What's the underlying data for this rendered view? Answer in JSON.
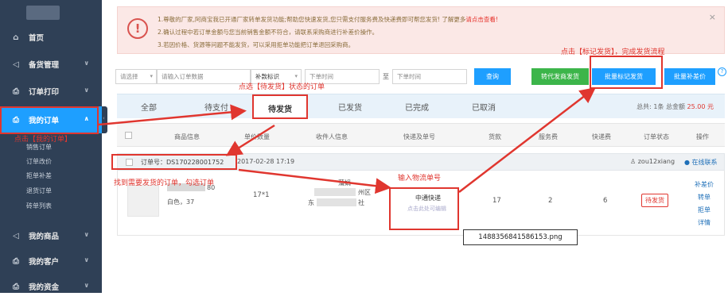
{
  "sidebar": {
    "items": [
      {
        "label": "首页",
        "icon": "home-icon",
        "glyph": "⌂",
        "chevron": ""
      },
      {
        "label": "备货管理",
        "icon": "speaker-icon",
        "glyph": "◁",
        "chevron": "∨"
      },
      {
        "label": "订单打印",
        "icon": "printer-icon",
        "glyph": "⎙",
        "chevron": "∨"
      },
      {
        "label": "我的订单",
        "icon": "printer-icon",
        "glyph": "⎙",
        "chevron": "∧"
      },
      {
        "label": "我的商品",
        "icon": "speaker-icon",
        "glyph": "◁",
        "chevron": "∨"
      },
      {
        "label": "我的客户",
        "icon": "printer-icon",
        "glyph": "⎙",
        "chevron": "∨"
      },
      {
        "label": "我的资金",
        "icon": "printer-icon",
        "glyph": "⎙",
        "chevron": "∨"
      }
    ],
    "subitems": [
      "销售订单",
      "订单改价",
      "拒单补差",
      "退货订单",
      "砖单列表"
    ]
  },
  "notice": {
    "line1_prefix": "1.尊敬的厂家,阿商宝我已开通厂家转单发货功能;帮助您快速发货,您只需支付服务费及快递费即可帮您发货! 了解更多",
    "line1_link": "请点击查看!",
    "line2": "2.确认过程中若订单金额与您当前销售金额不符合，请联系采购商进行补差价操作。",
    "line3": "3.若因价格、货源等问题不能发货，可以采用拒单功能把订单退回采购商。",
    "close": "×"
  },
  "filters": {
    "select1": "请选择",
    "order_placeholder": "请输入订单数据",
    "select2": "补款标识",
    "start_time": "下单时间",
    "range_sep": "至",
    "end_time": "下单时间",
    "query_button": "查询",
    "transfer_button": "转代发商发货",
    "batch_mark_button": "批量标记发货",
    "batch_diff_button": "批量补差价"
  },
  "tabs": {
    "items": [
      "全部",
      "待支付",
      "待发货",
      "已发货",
      "已完成",
      "已取消"
    ],
    "summary_prefix": "总共: 1条  总金额",
    "summary_amount": "25.00 元"
  },
  "table": {
    "headers": [
      "商品信息",
      "单价数量",
      "收件人信息",
      "快递及单号",
      "货款",
      "服务费",
      "快递费",
      "订单状态",
      "操作"
    ]
  },
  "order": {
    "number": "订单号：DS170228001752",
    "date": "2017-02-28 17:19",
    "user": "zou12xiang",
    "contact": "在线联系",
    "product_suffix": "80",
    "product_spec": "白色，37",
    "price_qty": "17*1",
    "recipient_name": "蒲娟",
    "recipient_l2": "州区",
    "recipient_l3_a": "东",
    "recipient_l3_b": "社",
    "courier": "中通快递",
    "courier_hint": "点击此处可编辑",
    "goods_fee": "17",
    "service_fee": "2",
    "shipping_fee": "6",
    "status": "待发货",
    "actions": [
      "补差价",
      "转单",
      "拒单",
      "详情"
    ]
  },
  "annotations": {
    "click_my_orders": "点击【我的订单】",
    "click_pending_tab": "点选【待发货】状态的订单",
    "find_and_check": "找到需要发货的订单，勾选订单",
    "input_tracking": "输入物流单号",
    "click_mark_shipped": "点击【标记发货】，完成发货流程"
  },
  "tooltip": "1488356841586153.png",
  "colors": {
    "sidebar_bg": "#2f4056",
    "active_nav": "#1e9fff",
    "annotation_red": "#e0362f",
    "query_blue": "#1e9fff",
    "transfer_green": "#3cb54a"
  }
}
